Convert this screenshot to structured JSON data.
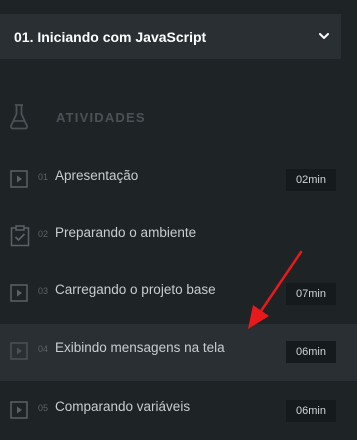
{
  "chapter": {
    "title": "01. Iniciando com JavaScript",
    "toggle_icon": "chevron-down-icon"
  },
  "section": {
    "label": "ATIVIDADES",
    "icon": "flask-icon"
  },
  "activities": [
    {
      "number": "01",
      "title": "Apresentação",
      "duration": "02min",
      "icon": "video-icon",
      "active": false
    },
    {
      "number": "02",
      "title": "Preparando o ambiente",
      "duration": "",
      "icon": "checklist-icon",
      "active": false
    },
    {
      "number": "03",
      "title": "Carregando o projeto base",
      "duration": "07min",
      "icon": "video-icon",
      "active": false
    },
    {
      "number": "04",
      "title": "Exibindo mensagens na tela",
      "duration": "06min",
      "icon": "video-icon",
      "active": true
    },
    {
      "number": "05",
      "title": "Comparando variáveis",
      "duration": "06min",
      "icon": "video-icon",
      "active": false
    }
  ],
  "colors": {
    "background": "#1e2326",
    "header_bg": "#2a2f33",
    "active_row_bg": "#2a2f33",
    "annotation_arrow": "#e8191b"
  }
}
